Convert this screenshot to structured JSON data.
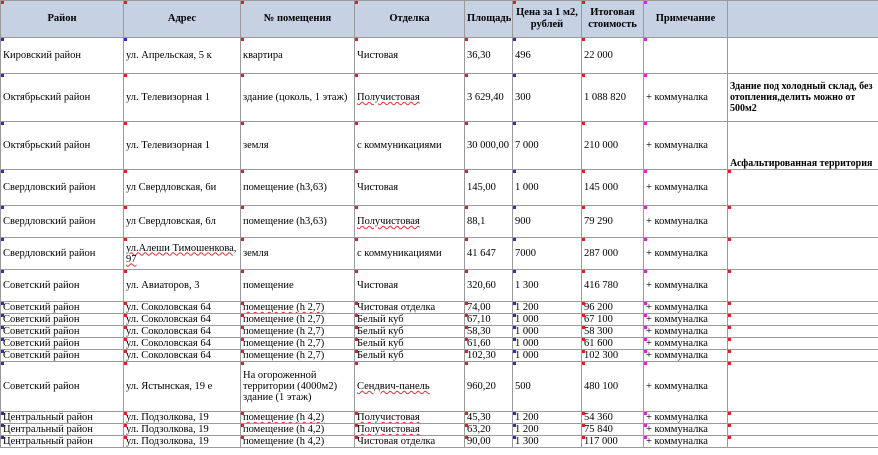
{
  "headers": {
    "district": "Район",
    "address": "Адрес",
    "premises": "№ помещения",
    "finish": "Отделка",
    "area": "Площадь",
    "price": "Цена за 1 м2, рублей",
    "total": "Итоговая стоимость",
    "note": "Примечание",
    "extra": ""
  },
  "rows": [
    {
      "district": "Кировский район",
      "address": "ул. Апрельская, 5 к",
      "premises": "квартира",
      "finish": "Чистовая",
      "area": "36,30",
      "price": "496",
      "total": "22 000",
      "note": "",
      "extra": ""
    },
    {
      "district": "Октябрьский район",
      "address": "ул. Телевизорная 1",
      "premises": "здание (цоколь, 1 этаж)",
      "finish": "Получистовая",
      "area": "3 629,40",
      "price": "300",
      "total": "1 088 820",
      "note": "+ коммуналка",
      "extra": "Здание под холодный склад, без отопления,делить можно от 500м2"
    },
    {
      "district": "Октябрьский район",
      "address": "ул. Телевизорная 1",
      "premises": "земля",
      "finish": "с коммуникациями",
      "area": "30 000,00",
      "price": "7 000",
      "total": "210 000",
      "note": "+ коммуналка",
      "extra": "Асфальтированная территория"
    },
    {
      "district": "Свердловский район",
      "address": "ул Свердловская, 6и",
      "premises": "помещение  (h3,63)",
      "finish": "Чистовая",
      "area": "145,00",
      "price": "1 000",
      "total": "145 000",
      "note": "+ коммуналка",
      "extra": ""
    },
    {
      "district": "Свердловский район",
      "address": "ул Свердловская, 6л",
      "premises": "помещение  (h3,63)",
      "finish": "Получистовая",
      "area": "88,1",
      "price": "900",
      "total": "79 290",
      "note": "+ коммуналка",
      "extra": ""
    },
    {
      "district": "Свердловский район",
      "address": "ул.Алеши Тимошенкова, 97",
      "premises": "земля",
      "finish": "с коммуникациями",
      "area": "41 647",
      "price": "7000",
      "total": "287 000",
      "note": "+ коммуналка",
      "extra": ""
    },
    {
      "district": "Советский район",
      "address": "ул. Авиаторов, 3",
      "premises": "помещение",
      "finish": "Чистовая",
      "area": "320,60",
      "price": "1 300",
      "total": "416 780",
      "note": "+ коммуналка",
      "extra": ""
    },
    {
      "district": "Советский район",
      "address": "ул. Соколовская 64",
      "premises": "помещение (h 2,7)",
      "finish": "Чистовая отделка",
      "area": "74,00",
      "price": "1 200",
      "total": "96 200",
      "note": "+ коммуналка",
      "extra": ""
    },
    {
      "district": "Советский район",
      "address": "ул. Соколовская 64",
      "premises": "помещение (h 2,7)",
      "finish": "Белый куб",
      "area": "67,10",
      "price": "1 000",
      "total": "67 100",
      "note": "+ коммуналка",
      "extra": ""
    },
    {
      "district": "Советский район",
      "address": "ул. Соколовская 64",
      "premises": "помещение (h 2,7)",
      "finish": "Белый куб",
      "area": "58,30",
      "price": "1 000",
      "total": "58 300",
      "note": "+ коммуналка",
      "extra": ""
    },
    {
      "district": "Советский район",
      "address": "ул. Соколовская 64",
      "premises": "помещение (h 2,7)",
      "finish": "Белый куб",
      "area": "61,60",
      "price": "1 000",
      "total": "61 600",
      "note": "+ коммуналка",
      "extra": ""
    },
    {
      "district": "Советский район",
      "address": "ул. Соколовская 64",
      "premises": "помещение (h 2,7)",
      "finish": "Белый куб",
      "area": "102,30",
      "price": "1 000",
      "total": "102 300",
      "note": "+ коммуналка",
      "extra": ""
    },
    {
      "district": "Советский район",
      "address": "ул. Ястынская, 19 е",
      "premises": "На огороженной территории (4000м2) здание (1 этаж)",
      "finish": "Сендвич-панель",
      "area": "960,20",
      "price": "500",
      "total": "480 100",
      "note": "+ коммуналка",
      "extra": ""
    },
    {
      "district": "Центральный район",
      "address": "ул. Подзолкова, 19",
      "premises": "помещение (h 4,2)",
      "finish": "Получистовая",
      "area": "45,30",
      "price": "1 200",
      "total": "54 360",
      "note": "+ коммуналка",
      "extra": ""
    },
    {
      "district": "Центральный район",
      "address": "ул. Подзолкова, 19",
      "premises": "помещение (h 4,2)",
      "finish": "Получистовая",
      "area": "63,20",
      "price": "1 200",
      "total": "75 840",
      "note": "+ коммуналка",
      "extra": ""
    },
    {
      "district": "Центральный район",
      "address": "ул. Подзолкова, 19",
      "premises": "помещение (h 4,2)",
      "finish": "Чистовая отделка",
      "area": "90,00",
      "price": "1 300",
      "total": "117 000",
      "note": "+ коммуналка",
      "extra": ""
    }
  ]
}
